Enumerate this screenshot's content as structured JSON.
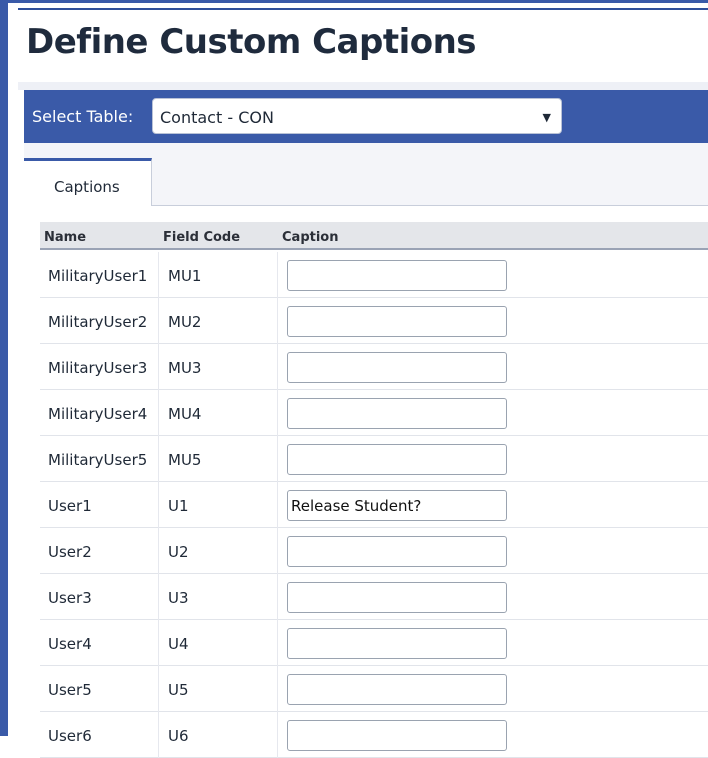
{
  "page": {
    "title": "Define Custom Captions"
  },
  "table_select": {
    "label": "Select Table:",
    "value": "Contact - CON"
  },
  "tabs": [
    {
      "label": "Captions"
    }
  ],
  "grid": {
    "columns": [
      "Name",
      "Field Code",
      "Caption"
    ],
    "rows": [
      {
        "name": "MilitaryUser1",
        "code": "MU1",
        "caption": ""
      },
      {
        "name": "MilitaryUser2",
        "code": "MU2",
        "caption": ""
      },
      {
        "name": "MilitaryUser3",
        "code": "MU3",
        "caption": ""
      },
      {
        "name": "MilitaryUser4",
        "code": "MU4",
        "caption": ""
      },
      {
        "name": "MilitaryUser5",
        "code": "MU5",
        "caption": ""
      },
      {
        "name": "User1",
        "code": "U1",
        "caption": "Release Student?"
      },
      {
        "name": "User2",
        "code": "U2",
        "caption": ""
      },
      {
        "name": "User3",
        "code": "U3",
        "caption": ""
      },
      {
        "name": "User4",
        "code": "U4",
        "caption": ""
      },
      {
        "name": "User5",
        "code": "U5",
        "caption": ""
      },
      {
        "name": "User6",
        "code": "U6",
        "caption": ""
      }
    ]
  },
  "colors": {
    "brand": "#3a5aa8",
    "title": "#1f2b3d"
  }
}
